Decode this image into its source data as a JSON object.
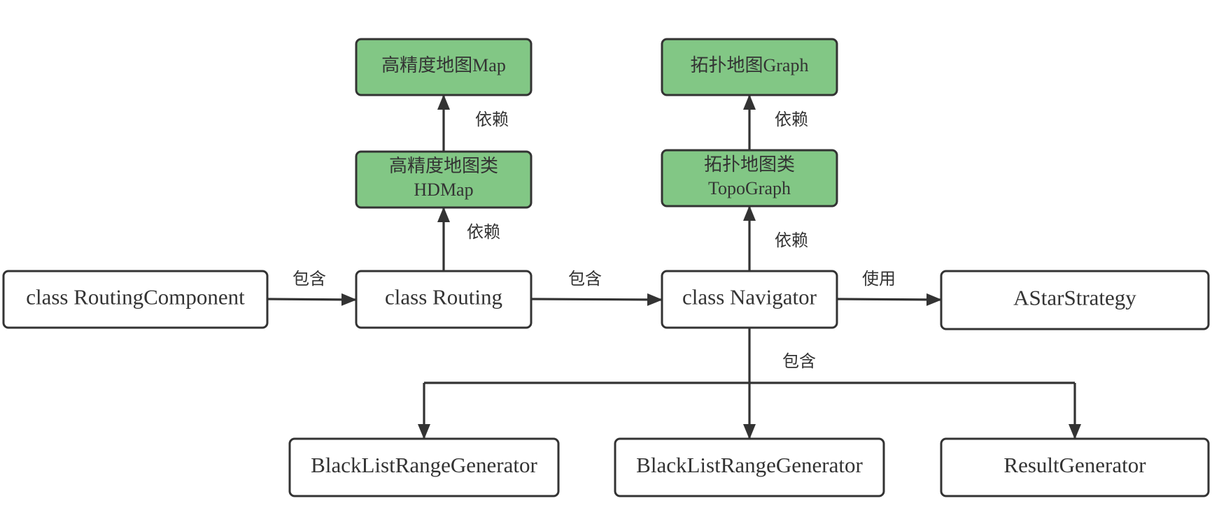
{
  "colors": {
    "stroke": "#333333",
    "green_fill": "#82c785",
    "white_fill": "#ffffff",
    "text": "#333333"
  },
  "nodes": {
    "hdmap_data": {
      "lines": [
        "高精度地图Map"
      ],
      "fill": "green"
    },
    "hdmap_class": {
      "lines": [
        "高精度地图类",
        "HDMap"
      ],
      "fill": "green"
    },
    "topo_data": {
      "lines": [
        "拓扑地图Graph"
      ],
      "fill": "green"
    },
    "topo_class": {
      "lines": [
        "拓扑地图类",
        "TopoGraph"
      ],
      "fill": "green"
    },
    "routing_component": {
      "lines": [
        "class RoutingComponent"
      ],
      "fill": "white"
    },
    "routing": {
      "lines": [
        "class Routing"
      ],
      "fill": "white"
    },
    "navigator": {
      "lines": [
        "class Navigator"
      ],
      "fill": "white"
    },
    "astar": {
      "lines": [
        "AStarStrategy"
      ],
      "fill": "white"
    },
    "blacklist_1": {
      "lines": [
        "BlackListRangeGenerator"
      ],
      "fill": "white"
    },
    "blacklist_2": {
      "lines": [
        "BlackListRangeGenerator"
      ],
      "fill": "white"
    },
    "result_generator": {
      "lines": [
        "ResultGenerator"
      ],
      "fill": "white"
    }
  },
  "edges": {
    "component_routing": {
      "from": "routing_component",
      "to": "routing",
      "label": "包含"
    },
    "routing_navigator": {
      "from": "routing",
      "to": "navigator",
      "label": "包含"
    },
    "navigator_astar": {
      "from": "navigator",
      "to": "astar",
      "label": "使用"
    },
    "routing_hdmap": {
      "from": "routing",
      "to": "hdmap_class",
      "label": "依赖"
    },
    "hdmap_map": {
      "from": "hdmap_class",
      "to": "hdmap_data",
      "label": "依赖"
    },
    "navigator_topo": {
      "from": "navigator",
      "to": "topo_class",
      "label": "依赖"
    },
    "topo_graph": {
      "from": "topo_class",
      "to": "topo_data",
      "label": "依赖"
    },
    "navigator_children": {
      "from": "navigator",
      "to": [
        "blacklist_1",
        "blacklist_2",
        "result_generator"
      ],
      "label": "包含"
    }
  }
}
